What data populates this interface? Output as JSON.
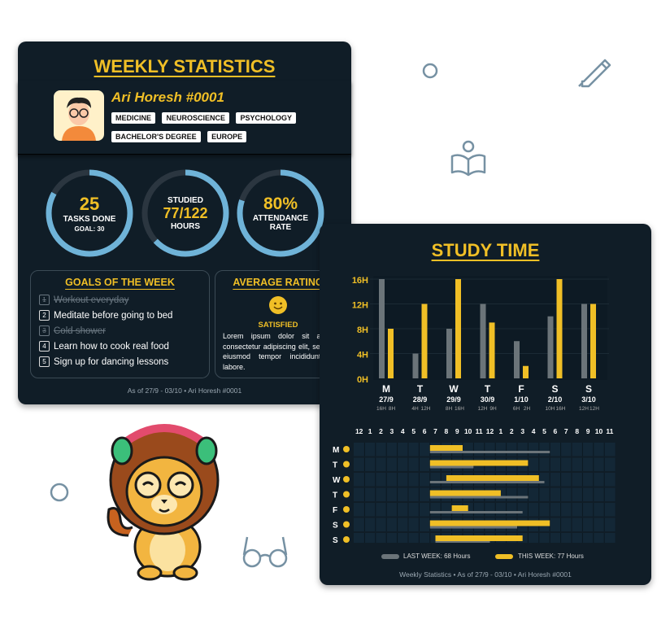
{
  "stats": {
    "title": "WEEKLY STATISTICS",
    "profile": {
      "name": "Ari Horesh #0001",
      "tags": [
        "MEDICINE",
        "NEUROSCIENCE",
        "PSYCHOLOGY",
        "BACHELOR'S DEGREE",
        "EUROPE"
      ]
    },
    "rings": [
      {
        "big": "25",
        "line1": "TASKS DONE",
        "line2": "GOAL: 30",
        "progress": 0.83
      },
      {
        "top": "STUDIED",
        "big": "77/122",
        "line1": "HOURS",
        "progress": 0.63
      },
      {
        "big": "80%",
        "line1": "ATTENDANCE",
        "line2": "RATE",
        "progress": 0.8
      }
    ],
    "goals": {
      "title": "GOALS OF THE WEEK",
      "items": [
        {
          "n": "1",
          "text": "Workout everyday",
          "done": true
        },
        {
          "n": "2",
          "text": "Meditate before going to bed",
          "done": false
        },
        {
          "n": "3",
          "text": "Cold shower",
          "done": true
        },
        {
          "n": "4",
          "text": "Learn how to cook real food",
          "done": false
        },
        {
          "n": "5",
          "text": "Sign up for dancing lessons",
          "done": false
        }
      ]
    },
    "rating": {
      "title": "AVERAGE RATING",
      "label": "SATISFIED",
      "text": "Lorem ipsum dolor sit amet, consectetur adipiscing elit, sed do eiusmod tempor incididunt ut labore."
    },
    "footer": "As of 27/9 - 03/10 • Ari Horesh #0001"
  },
  "study": {
    "title": "STUDY TIME",
    "footer": "Weekly Statistics • As of 27/9 - 03/10 • Ari Horesh #0001",
    "colors": {
      "last_week": "#6b7479",
      "this_week": "#f0bf26"
    },
    "chart_data": {
      "type": "bar",
      "ylabel_ticks": [
        "0H",
        "4H",
        "8H",
        "12H",
        "16H"
      ],
      "ylim": [
        0,
        16
      ],
      "categories": [
        "M",
        "T",
        "W",
        "T",
        "F",
        "S",
        "S"
      ],
      "dates": [
        "27/9",
        "28/9",
        "29/9",
        "30/9",
        "1/10",
        "2/10",
        "3/10"
      ],
      "series": [
        {
          "values": [
            16,
            4,
            8,
            12,
            6,
            10,
            12
          ]
        },
        {
          "values": [
            8,
            12,
            16,
            9,
            2,
            16,
            12
          ]
        }
      ],
      "value_labels": [
        [
          "16H",
          "8H"
        ],
        [
          "4H",
          "12H"
        ],
        [
          "8H",
          "16H"
        ],
        [
          "12H",
          "9H"
        ],
        [
          "6H",
          "2H"
        ],
        [
          "10H",
          "16H"
        ],
        [
          "12H",
          "12H"
        ]
      ]
    },
    "timeline": {
      "hours": [
        "12",
        "1",
        "2",
        "3",
        "4",
        "5",
        "6",
        "7",
        "8",
        "9",
        "10",
        "11",
        "12",
        "1",
        "2",
        "3",
        "4",
        "5",
        "6",
        "7",
        "8",
        "9",
        "10",
        "11"
      ],
      "days": [
        "M",
        "T",
        "W",
        "T",
        "F",
        "S",
        "S"
      ],
      "last_week": [
        [
          7,
          18
        ],
        [
          7,
          11
        ],
        [
          7,
          17.5
        ],
        [
          7,
          16
        ],
        [
          7,
          15.5
        ],
        [
          7,
          15
        ],
        [
          7.5,
          12.5
        ]
      ],
      "this_week": [
        [
          7,
          10
        ],
        [
          7,
          16
        ],
        [
          8.5,
          17
        ],
        [
          7,
          13.5
        ],
        [
          9,
          10.5
        ],
        [
          7,
          18
        ],
        [
          7.5,
          15.5
        ]
      ],
      "legend_last": "LAST WEEK: 68 Hours",
      "legend_this": "THIS WEEK: 77 Hours"
    }
  }
}
